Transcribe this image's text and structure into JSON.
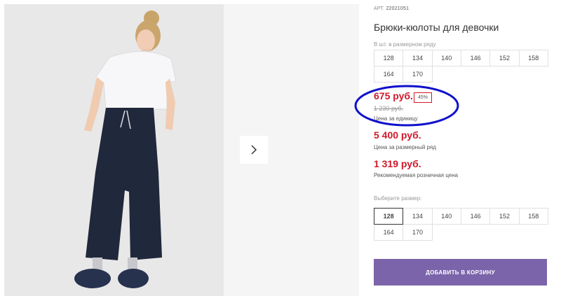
{
  "product": {
    "art_label": "АРТ.",
    "art_value": "22021051",
    "title": "Брюки-кюлоты для девочки"
  },
  "sizes_in_row": {
    "hint": "В шт. в размерном ряду",
    "sizes": [
      "128",
      "134",
      "140",
      "146",
      "152",
      "158",
      "164",
      "170"
    ]
  },
  "pricing": {
    "unit_price": "675 руб.",
    "discount": "45%",
    "old_price": "1 230 руб.",
    "unit_label": "Цена за единицу",
    "set_price": "5 400 руб.",
    "set_label": "Цена за размерный ряд",
    "rrp_price": "1 319 руб.",
    "rrp_label": "Рекомендуемая розничная цена"
  },
  "size_select": {
    "label": "Выберите размер:",
    "sizes": [
      "128",
      "134",
      "140",
      "146",
      "152",
      "158",
      "164",
      "170"
    ],
    "selected": "128"
  },
  "cart": {
    "add_label": "ДОБАВИТЬ В КОРЗИНУ"
  },
  "gallery": {
    "next_icon": "chevron-right-icon"
  },
  "colors": {
    "price_red": "#d0182a",
    "button_purple": "#7b64aa",
    "annotation_blue": "#1010cc"
  }
}
